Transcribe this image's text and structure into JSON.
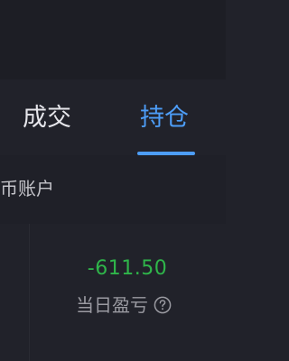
{
  "tabs": {
    "deals_label": "成交",
    "positions_label": "持仓",
    "active": "持仓",
    "accent_color": "#4d9df7"
  },
  "account": {
    "label": "币账户"
  },
  "summary": {
    "daily_pnl_value": "-611.50",
    "daily_pnl_label": "当日盈亏",
    "value_color": "#2fb54a",
    "help_icon": "help-circle-icon"
  }
}
